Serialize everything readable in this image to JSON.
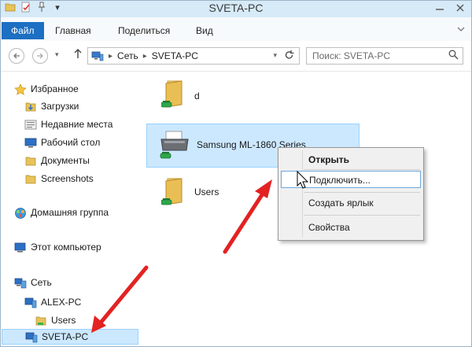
{
  "window": {
    "title": "SVETA-PC",
    "minimize_icon": "minimize-icon",
    "close_icon": "close-icon"
  },
  "ribbon": {
    "tabs": [
      {
        "label": "Файл"
      },
      {
        "label": "Главная"
      },
      {
        "label": "Поделиться"
      },
      {
        "label": "Вид"
      }
    ]
  },
  "address": {
    "crumbs": [
      "Сеть",
      "SVETA-PC"
    ],
    "search_placeholder": "Поиск: SVETA-PC"
  },
  "sidebar": {
    "items": [
      {
        "label": "Избранное",
        "icon": "star-icon"
      },
      {
        "label": "Загрузки",
        "icon": "downloads-icon"
      },
      {
        "label": "Недавние места",
        "icon": "recent-places-icon"
      },
      {
        "label": "Рабочий стол",
        "icon": "desktop-icon"
      },
      {
        "label": "Документы",
        "icon": "folder-icon"
      },
      {
        "label": "Screenshots",
        "icon": "folder-icon"
      },
      {
        "label": "Домашняя группа",
        "icon": "homegroup-icon"
      },
      {
        "label": "Этот компьютер",
        "icon": "computer-icon"
      },
      {
        "label": "Сеть",
        "icon": "network-icon"
      },
      {
        "label": "ALEX-PC",
        "icon": "computer-icon"
      },
      {
        "label": "Users",
        "icon": "shared-folder-icon"
      },
      {
        "label": "SVETA-PC",
        "icon": "computer-icon"
      }
    ]
  },
  "content": {
    "items": [
      {
        "label": "d",
        "icon": "shared-folder-icon"
      },
      {
        "label": "Samsung ML-1860 Series",
        "icon": "printer-icon"
      },
      {
        "label": "Users",
        "icon": "shared-folder-icon"
      }
    ]
  },
  "context_menu": {
    "items": [
      {
        "label": "Открыть"
      },
      {
        "label": "Подключить..."
      },
      {
        "label": "Создать ярлык"
      },
      {
        "label": "Свойства"
      }
    ]
  },
  "colors": {
    "file_tab": "#1c6fc2",
    "selection": "#cce8ff",
    "arrow": "#e32222"
  }
}
